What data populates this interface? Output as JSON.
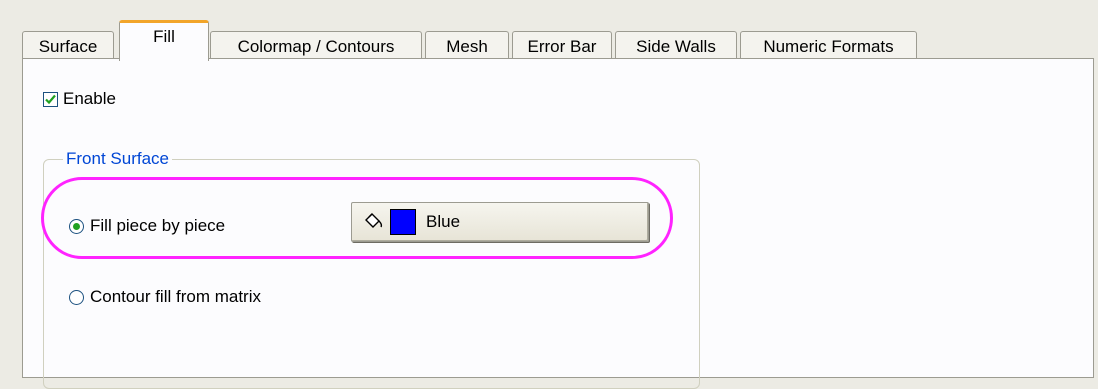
{
  "tabs": [
    {
      "label": "Surface",
      "active": false
    },
    {
      "label": "Fill",
      "active": true
    },
    {
      "label": "Colormap / Contours",
      "active": false
    },
    {
      "label": "Mesh",
      "active": false
    },
    {
      "label": "Error Bar",
      "active": false
    },
    {
      "label": "Side Walls",
      "active": false
    },
    {
      "label": "Numeric Formats",
      "active": false
    }
  ],
  "fill": {
    "enable_label": "Enable",
    "enable_checked": true,
    "front_surface": {
      "title": "Front Surface",
      "options": [
        {
          "label": "Fill piece by piece",
          "selected": true
        },
        {
          "label": "Contour fill from matrix",
          "selected": false
        }
      ],
      "color_button": {
        "label": "Blue",
        "swatch_color": "#0000ff",
        "icon": "paint-bucket-icon"
      }
    }
  },
  "colors": {
    "active_tab_accent": "#f2a52a",
    "highlight_ring": "#ff23ff",
    "group_title": "#0046d5",
    "radio_selected": "#21a121"
  }
}
